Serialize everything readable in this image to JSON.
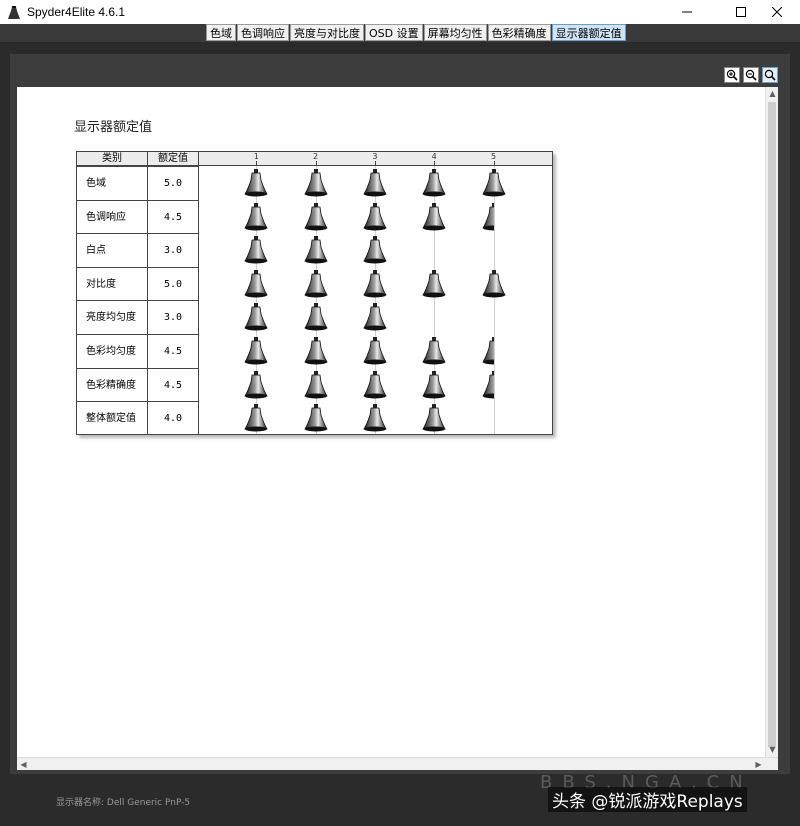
{
  "window": {
    "title": "Spyder4Elite 4.6.1",
    "app_icon": "spyder-sensor-icon",
    "minimize_icon": "minimize-icon",
    "maximize_icon": "maximize-icon",
    "close_icon": "close-icon"
  },
  "tabs": [
    {
      "label": "色域"
    },
    {
      "label": "色调响应"
    },
    {
      "label": "亮度与对比度"
    },
    {
      "label": "OSD 设置"
    },
    {
      "label": "屏幕均匀性"
    },
    {
      "label": "色彩精确度"
    },
    {
      "label": "显示器额定值",
      "active": true
    }
  ],
  "toolbar": {
    "zoom_in_icon": "zoom-in-icon",
    "zoom_out_icon": "zoom-out-icon",
    "zoom_fit_icon": "zoom-fit-icon"
  },
  "report": {
    "title": "显示器额定值",
    "headers": {
      "category": "类别",
      "rating": "额定值"
    },
    "scale_ticks": [
      "1",
      "2",
      "3",
      "4",
      "5"
    ],
    "rows": [
      {
        "category": "色域",
        "rating_label": "5.0",
        "rating": 5.0
      },
      {
        "category": "色调响应",
        "rating_label": "4.5",
        "rating": 4.5
      },
      {
        "category": "白点",
        "rating_label": "3.0",
        "rating": 3.0
      },
      {
        "category": "对比度",
        "rating_label": "5.0",
        "rating": 5.0
      },
      {
        "category": "亮度均匀度",
        "rating_label": "3.0",
        "rating": 3.0
      },
      {
        "category": "色彩均匀度",
        "rating_label": "4.5",
        "rating": 4.5
      },
      {
        "category": "色彩精确度",
        "rating_label": "4.5",
        "rating": 4.5
      },
      {
        "category": "整体额定值",
        "rating_label": "4.0",
        "rating": 4.0
      }
    ]
  },
  "status": {
    "display_name": "显示器名称: Dell Generic PnP-5"
  },
  "watermark": {
    "ghost": "BBS.NGA.CN",
    "text": "头条 @锐派游戏Replays"
  }
}
